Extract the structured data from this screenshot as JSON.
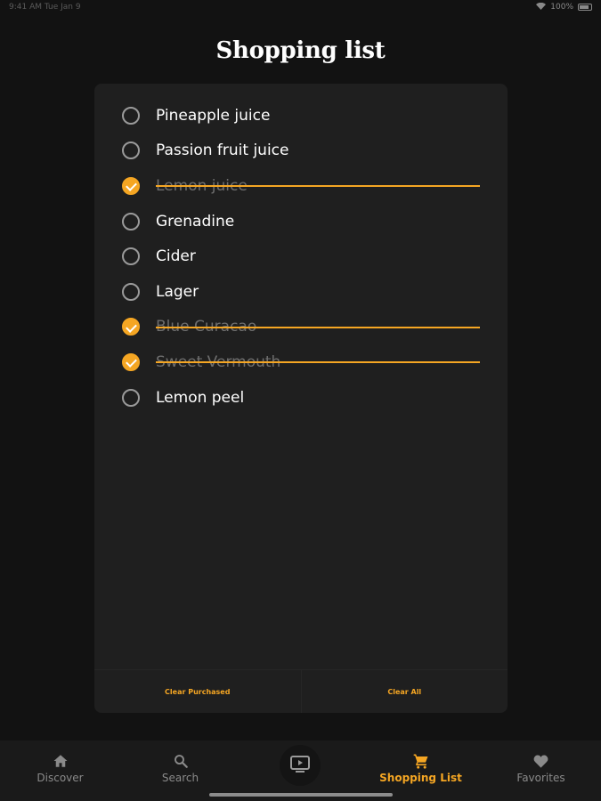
{
  "status_bar": {
    "left_text": "9:41 AM  Tue Jan 9",
    "battery_percent": "100%"
  },
  "header": {
    "title": "Shopping list"
  },
  "shopping_list": {
    "items": [
      {
        "label": "Pineapple juice",
        "checked": false
      },
      {
        "label": "Passion fruit juice",
        "checked": false
      },
      {
        "label": "Lemon juice",
        "checked": true
      },
      {
        "label": "Grenadine",
        "checked": false
      },
      {
        "label": "Cider",
        "checked": false
      },
      {
        "label": "Lager",
        "checked": false
      },
      {
        "label": "Blue Curacao",
        "checked": true
      },
      {
        "label": "Sweet Vermouth",
        "checked": true
      },
      {
        "label": "Lemon peel",
        "checked": false
      }
    ],
    "clear_purchased_label": "Clear Purchased",
    "clear_all_label": "Clear All"
  },
  "tab_bar": {
    "tabs": [
      {
        "label": "Discover",
        "icon": "home-icon",
        "active": false
      },
      {
        "label": "Search",
        "icon": "search-icon",
        "active": false
      },
      {
        "label": "",
        "icon": "tv-play-icon",
        "active": false
      },
      {
        "label": "Shopping List",
        "icon": "cart-icon",
        "active": true
      },
      {
        "label": "Favorites",
        "icon": "heart-icon",
        "active": false
      }
    ]
  },
  "colors": {
    "accent": "#f5a623",
    "background": "#121212",
    "card": "#1f1f1f",
    "tab_bar": "#1a1a1a",
    "inactive_text": "#8a8a8a"
  }
}
